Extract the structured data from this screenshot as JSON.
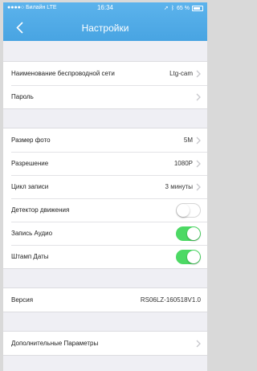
{
  "status_bar": {
    "carrier": "●●●●○ Билайн LTE",
    "time": "16:34",
    "battery": "65 %"
  },
  "header": {
    "title": "Настройки"
  },
  "sections": {
    "network": {
      "ssid_label": "Наименование беспроводной сети",
      "ssid_value": "Ltg-cam",
      "password_label": "Пароль"
    },
    "camera": {
      "photo_size_label": "Размер фото",
      "photo_size_value": "5M",
      "resolution_label": "Разрешение",
      "resolution_value": "1080P",
      "loop_label": "Цикл записи",
      "loop_value": "3 минуты",
      "motion_label": "Детектор движения",
      "motion_on": false,
      "audio_label": "Запись Аудио",
      "audio_on": true,
      "date_label": "Штамп Даты",
      "date_on": true
    },
    "version": {
      "label": "Версия",
      "value": "RS06LZ-160518V1.0"
    },
    "advanced": {
      "label": "Дополнительные Параметры"
    }
  },
  "colors": {
    "header": "#4da8e6",
    "toggle_on": "#4cd964",
    "background": "#efeff4"
  }
}
